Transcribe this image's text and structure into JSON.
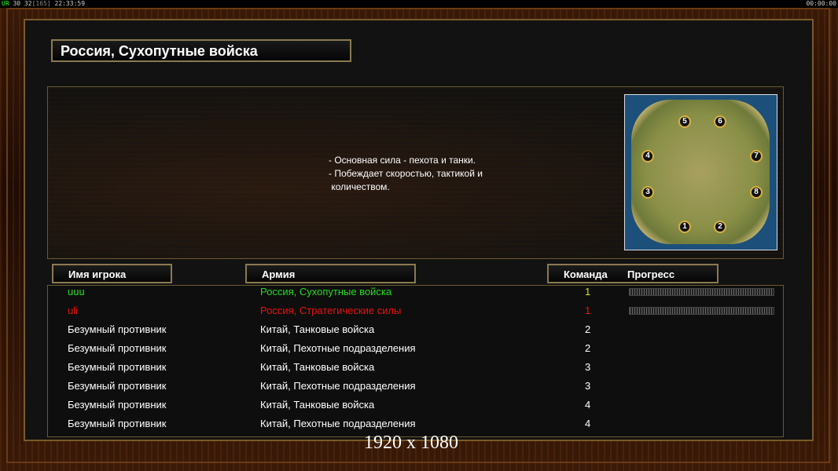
{
  "status_bar": {
    "left_green": "UR",
    "left_nums": "30 32",
    "left_dim": "[165]",
    "left_time": "22:33:59",
    "right_time": "00:00:00"
  },
  "title": "Россия, Сухопутные войска",
  "description": "- Основная сила - пехота и танки.\n- Побеждает скоростью, тактикой и\n количеством.",
  "minimap": {
    "slots": [
      "1",
      "2",
      "3",
      "4",
      "5",
      "6",
      "7",
      "8"
    ]
  },
  "columns": {
    "name": "Имя игрока",
    "army": "Армия",
    "team": "Команда",
    "progress": "Прогресс"
  },
  "players": [
    {
      "name": "uuu",
      "army": "Россия, Сухопутные войска",
      "team": "1",
      "color": "#22dd22",
      "team_color": "#dddd22",
      "has_progress": true
    },
    {
      "name": "uli",
      "army": "Россия, Стратегические силы",
      "team": "1",
      "color": "#ee1111",
      "team_color": "#ee1111",
      "has_progress": true
    },
    {
      "name": "Безумный противник",
      "army": "Китай, Танковые войска",
      "team": "2",
      "color": "#ffffff",
      "team_color": "#ffffff",
      "has_progress": false
    },
    {
      "name": "Безумный противник",
      "army": "Китай, Пехотные подразделения",
      "team": "2",
      "color": "#ffffff",
      "team_color": "#ffffff",
      "has_progress": false
    },
    {
      "name": "Безумный противник",
      "army": "Китай, Танковые войска",
      "team": "3",
      "color": "#ffffff",
      "team_color": "#ffffff",
      "has_progress": false
    },
    {
      "name": "Безумный противник",
      "army": "Китай, Пехотные подразделения",
      "team": "3",
      "color": "#ffffff",
      "team_color": "#ffffff",
      "has_progress": false
    },
    {
      "name": "Безумный противник",
      "army": "Китай, Танковые войска",
      "team": "4",
      "color": "#ffffff",
      "team_color": "#ffffff",
      "has_progress": false
    },
    {
      "name": "Безумный противник",
      "army": "Китай, Пехотные подразделения",
      "team": "4",
      "color": "#ffffff",
      "team_color": "#ffffff",
      "has_progress": false
    }
  ],
  "resolution_label": "1920 x 1080"
}
